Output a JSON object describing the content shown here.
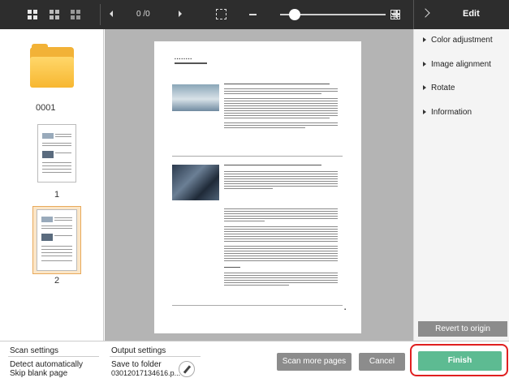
{
  "toolbar": {
    "page_counter": "0 /0",
    "zoom_percent": 0.14
  },
  "edit_panel": {
    "title": "Edit",
    "items": [
      {
        "label": "Color adjustment"
      },
      {
        "label": "Image alignment"
      },
      {
        "label": "Rotate"
      },
      {
        "label": "Information"
      }
    ],
    "revert_label": "Revert to origin"
  },
  "thumbnails": {
    "folder_label": "0001",
    "pages": [
      {
        "label": "1"
      },
      {
        "label": "2"
      }
    ]
  },
  "bottom": {
    "scan_settings_title": "Scan settings",
    "scan_settings_values": [
      "Detect automatically",
      "Skip blank page"
    ],
    "output_settings_title": "Output settings",
    "output_settings_values": [
      "Save to folder",
      "03012017134616.p..."
    ],
    "scan_more_label": "Scan more pages",
    "cancel_label": "Cancel",
    "finish_label": "Finish"
  },
  "colors": {
    "toolbar_bg": "#2d2d2d",
    "finish_green": "#5dbb92",
    "highlight_red": "#e02020",
    "selected_thumb": "#fbe6c8"
  }
}
